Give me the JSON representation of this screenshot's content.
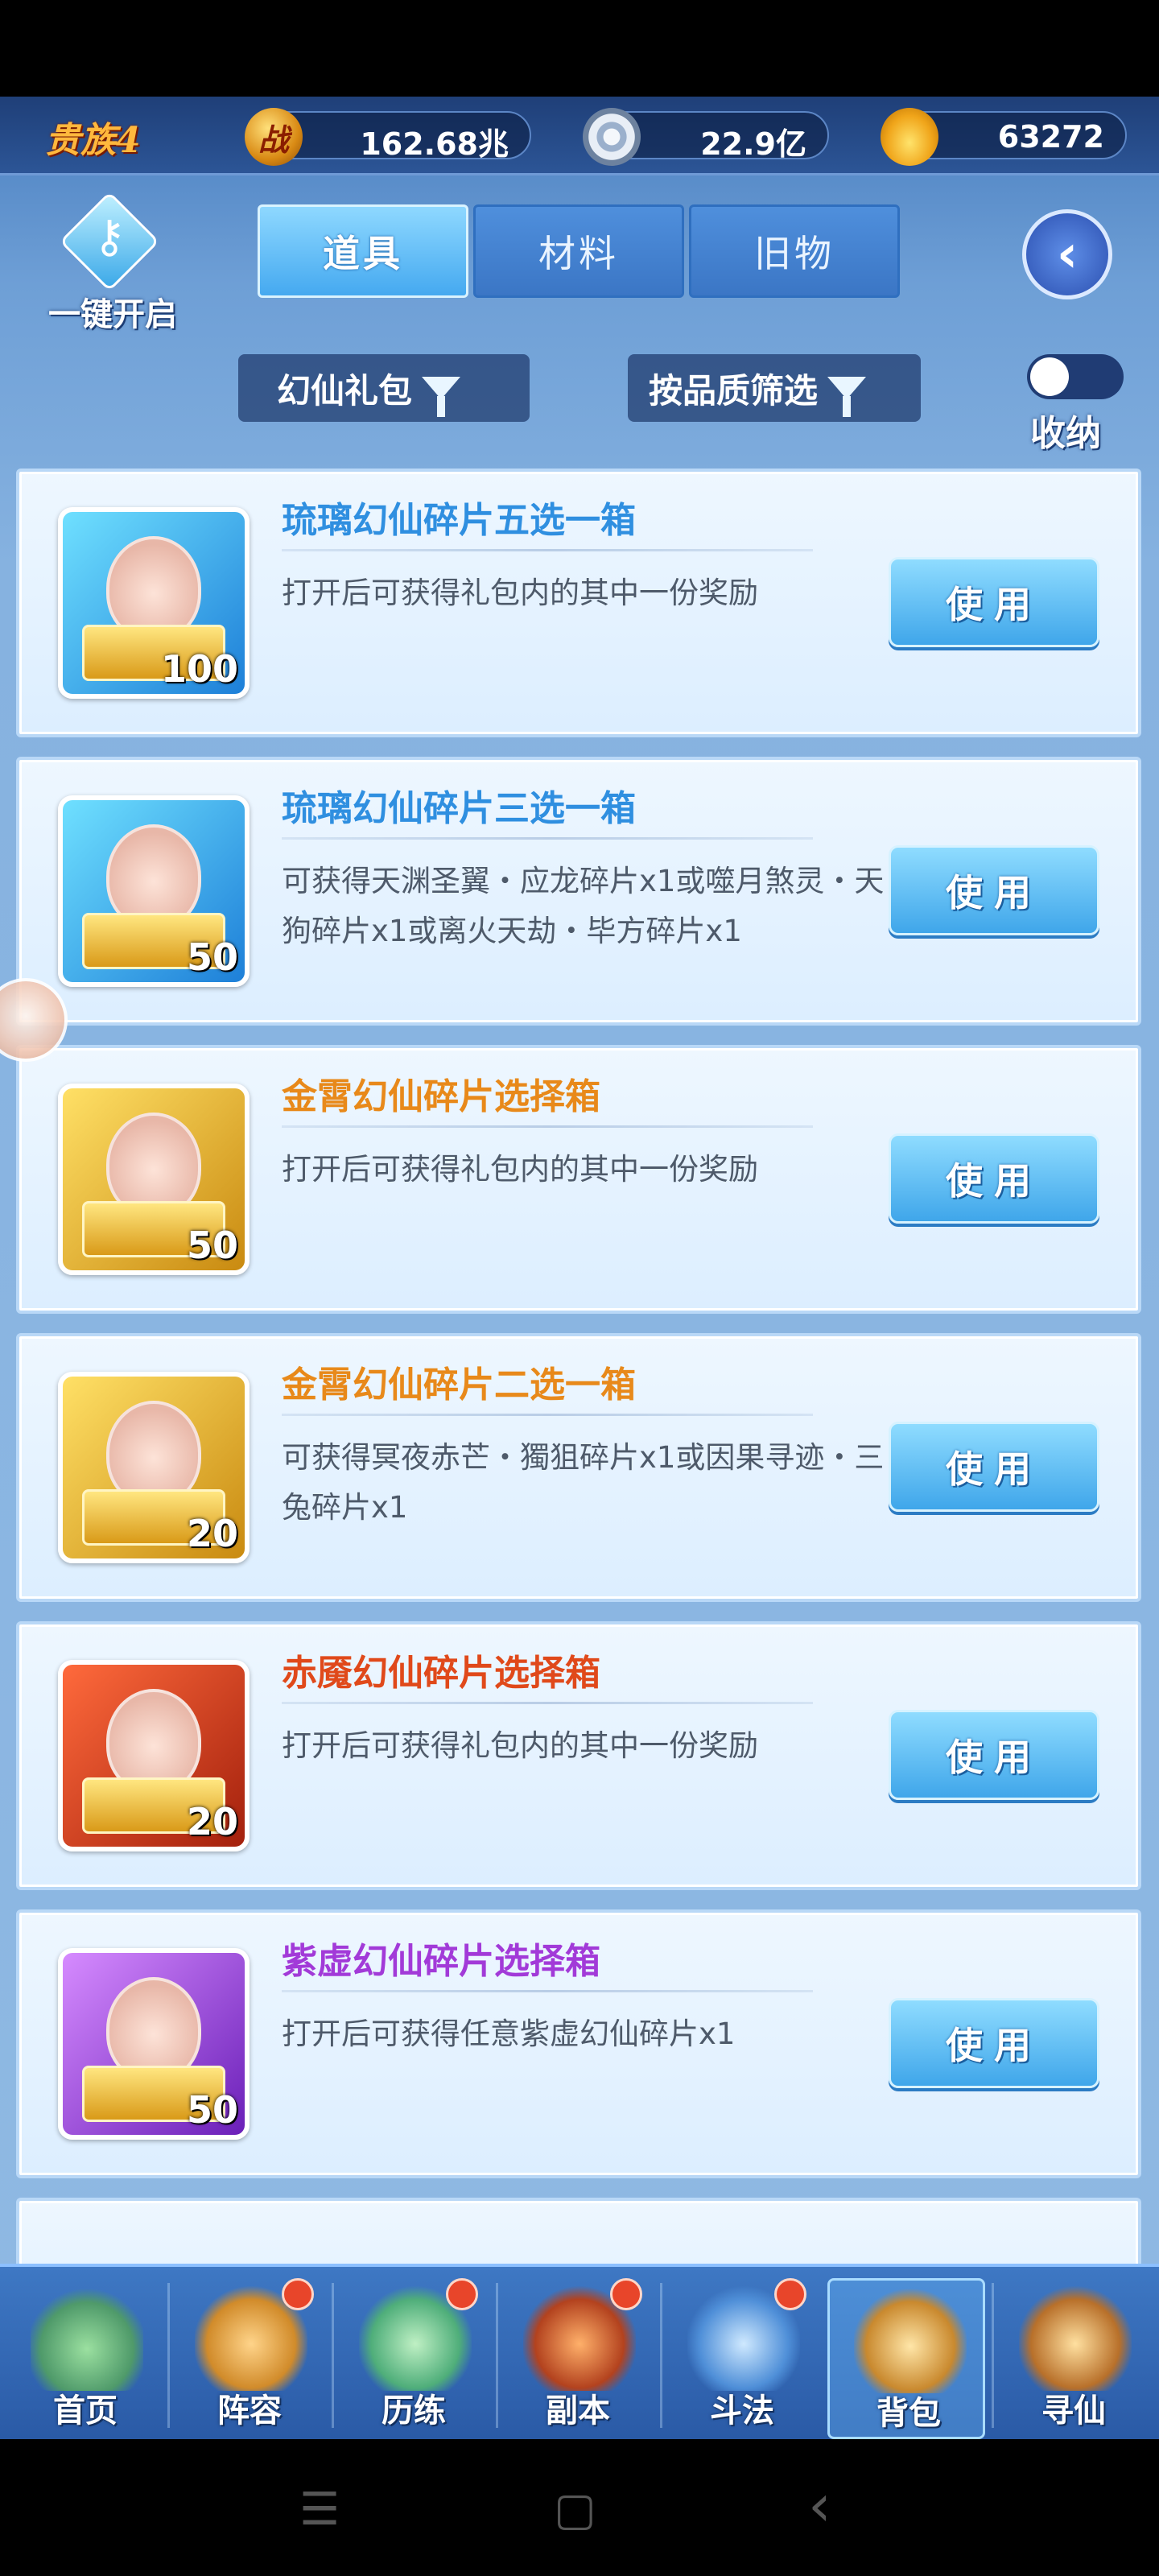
{
  "resources": {
    "rank": "贵族4",
    "power_icon": "战",
    "power": "162.68兆",
    "coin": "22.9亿",
    "ingot": "63272"
  },
  "controls": {
    "open_all": "一键开启",
    "tabs": [
      {
        "label": "道具",
        "active": true
      },
      {
        "label": "材料",
        "active": false
      },
      {
        "label": "旧物",
        "active": false
      }
    ],
    "back_icon": "back-arrow-icon",
    "filter_type": "幻仙礼包",
    "filter_quality": "按品质筛选",
    "collapse_label": "收纳",
    "collapse_on": false
  },
  "items": [
    {
      "title": "琉璃幻仙碎片五选一箱",
      "color": "#2f8fe0",
      "desc": "打开后可获得礼包内的其中一份奖励",
      "count": "100",
      "frame": "blue",
      "button": "使用"
    },
    {
      "title": "琉璃幻仙碎片三选一箱",
      "color": "#2f8fe0",
      "desc": "可获得天渊圣翼・应龙碎片x1或噬月煞灵・天狗碎片x1或离火天劫・毕方碎片x1",
      "count": "50",
      "frame": "blue",
      "button": "使用"
    },
    {
      "title": "金霄幻仙碎片选择箱",
      "color": "#e8891a",
      "desc": "打开后可获得礼包内的其中一份奖励",
      "count": "50",
      "frame": "gold",
      "button": "使用"
    },
    {
      "title": "金霄幻仙碎片二选一箱",
      "color": "#e8891a",
      "desc": "可获得冥夜赤芒・獨狙碎片x1或因果寻迹・三兔碎片x1",
      "count": "20",
      "frame": "gold",
      "button": "使用"
    },
    {
      "title": "赤魇幻仙碎片选择箱",
      "color": "#e0491a",
      "desc": "打开后可获得礼包内的其中一份奖励",
      "count": "20",
      "frame": "red",
      "button": "使用"
    },
    {
      "title": "紫虚幻仙碎片选择箱",
      "color": "#a23ad8",
      "desc": "打开后可获得任意紫虚幻仙碎片x1",
      "count": "50",
      "frame": "purple",
      "button": "使用"
    }
  ],
  "nav": [
    {
      "label": "首页",
      "icon": "home-island-icon",
      "dot": false,
      "active": false
    },
    {
      "label": "阵容",
      "icon": "cards-icon",
      "dot": true,
      "active": false
    },
    {
      "label": "历练",
      "icon": "gourd-icon",
      "dot": true,
      "active": false
    },
    {
      "label": "副本",
      "icon": "gate-icon",
      "dot": true,
      "active": false
    },
    {
      "label": "斗法",
      "icon": "sword-icon",
      "dot": true,
      "active": false
    },
    {
      "label": "背包",
      "icon": "bag-icon",
      "dot": false,
      "active": true
    },
    {
      "label": "寻仙",
      "icon": "scroll-icon",
      "dot": false,
      "active": false
    }
  ],
  "system_nav": {
    "menu": "☰",
    "home": "▢",
    "back": "‹"
  }
}
